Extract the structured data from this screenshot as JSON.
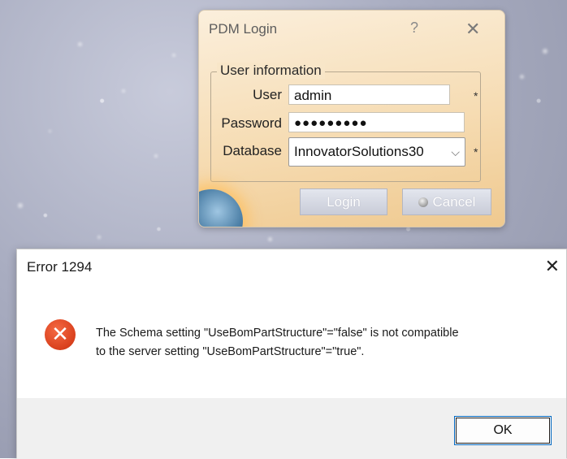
{
  "pdm_dialog": {
    "title": "PDM Login",
    "help_glyph": "?",
    "close_glyph": "✕",
    "group_label": "User information",
    "user": {
      "label": "User",
      "value": "admin",
      "required": "*"
    },
    "password": {
      "label": "Password",
      "value": "●●●●●●●●●"
    },
    "database": {
      "label": "Database",
      "value": "InnovatorSolutions30",
      "required": "*"
    },
    "login_button": "Login",
    "cancel_button": "Cancel"
  },
  "error_dialog": {
    "title": "Error 1294",
    "close_glyph": "✕",
    "icon": "error-x-icon",
    "icon_color": "#d9401d",
    "message_line1": "The Schema setting \"UseBomPartStructure\"=\"false\" is not compatible",
    "message_line2": "to the server setting \"UseBomPartStructure\"=\"true\".",
    "ok_button": "OK"
  }
}
